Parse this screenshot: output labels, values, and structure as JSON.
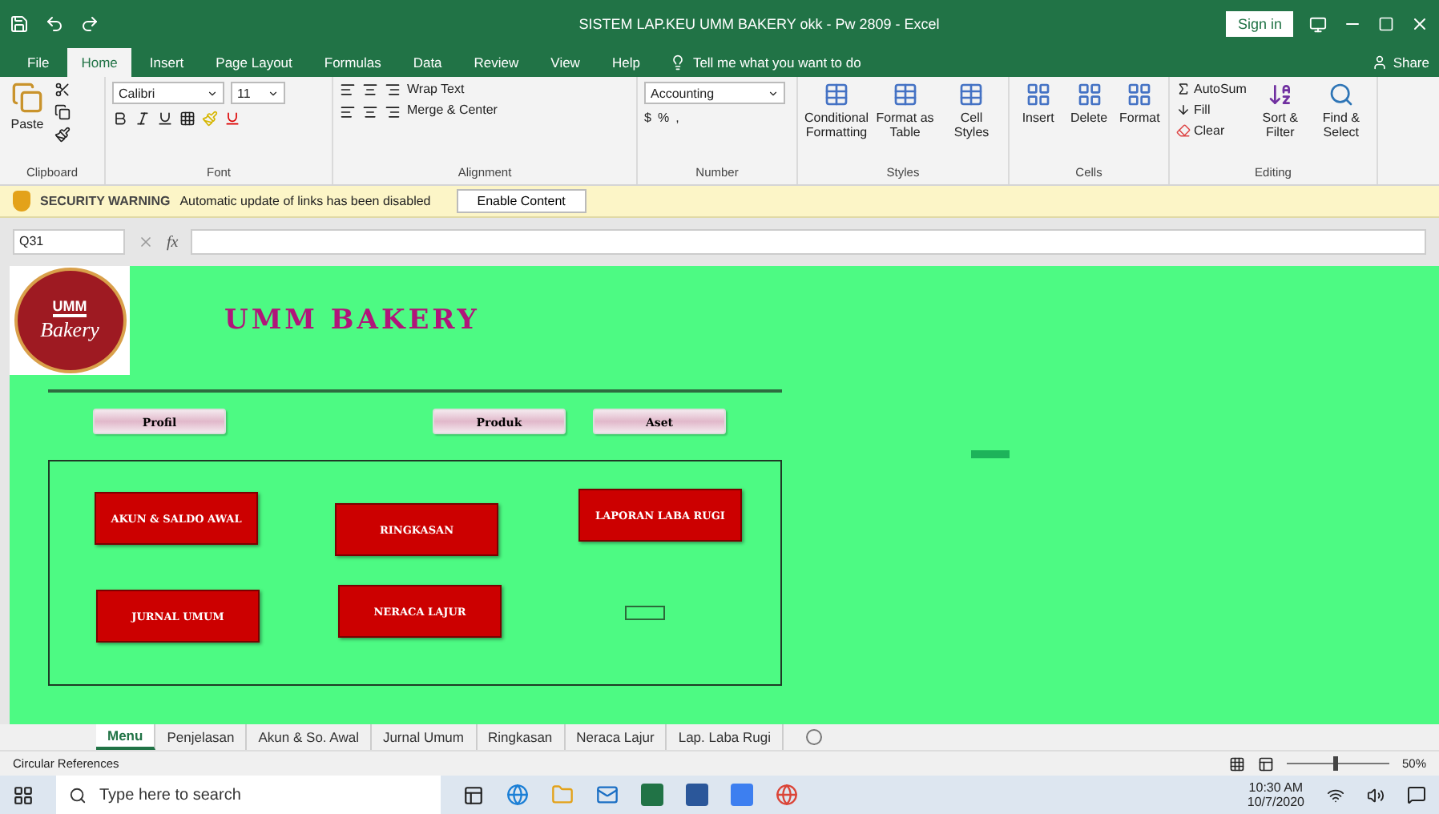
{
  "window": {
    "title": "SISTEM LAP.KEU UMM BAKERY okk - Pw 2809  -  Excel",
    "sign_in": "Sign in"
  },
  "ribbon_tabs": [
    {
      "label": "File",
      "selected": false
    },
    {
      "label": "Home",
      "selected": true
    },
    {
      "label": "Insert",
      "selected": false
    },
    {
      "label": "Page Layout",
      "selected": false
    },
    {
      "label": "Formulas",
      "selected": false
    },
    {
      "label": "Data",
      "selected": false
    },
    {
      "label": "Review",
      "selected": false
    },
    {
      "label": "View",
      "selected": false
    },
    {
      "label": "Help",
      "selected": false
    }
  ],
  "tell_me": "Tell me what you want to do",
  "share": "Share",
  "ribbon": {
    "clipboard": {
      "label": "Clipboard",
      "paste": "Paste"
    },
    "font": {
      "label": "Font",
      "name": "Calibri",
      "size": "11"
    },
    "alignment": {
      "label": "Alignment",
      "wrap": "Wrap Text",
      "merge": "Merge & Center"
    },
    "number": {
      "label": "Number",
      "format": "Accounting",
      "currency": "$",
      "percent": "%",
      "comma": ","
    },
    "styles": {
      "label": "Styles",
      "buttons": [
        "Conditional Formatting",
        "Format as Table",
        "Cell Styles"
      ]
    },
    "cells": {
      "label": "Cells",
      "buttons": [
        "Insert",
        "Delete",
        "Format"
      ]
    },
    "editing": {
      "label": "Editing",
      "autosum": "AutoSum",
      "fill": "Fill",
      "clear": "Clear",
      "sort": "Sort & Filter",
      "find": "Find & Select"
    }
  },
  "warning": {
    "title": "SECURITY WARNING",
    "message": "Automatic update of links has been disabled",
    "button": "Enable Content"
  },
  "formula_bar": {
    "name_box": "Q31",
    "fx": "fx"
  },
  "sheet": {
    "logo_top": "UMM",
    "logo_bottom": "Bakery",
    "title": "UMM BAKERY",
    "nav_buttons": [
      "Profil",
      "Produk",
      "Aset"
    ],
    "menu_buttons": [
      "AKUN & SALDO AWAL",
      "RINGKASAN",
      "LAPORAN LABA RUGI",
      "JURNAL UMUM",
      "NERACA LAJUR"
    ]
  },
  "sheet_tabs": [
    {
      "label": "Menu",
      "selected": true
    },
    {
      "label": "Penjelasan",
      "selected": false
    },
    {
      "label": "Akun & So. Awal",
      "selected": false
    },
    {
      "label": "Jurnal Umum",
      "selected": false
    },
    {
      "label": "Ringkasan",
      "selected": false
    },
    {
      "label": "Neraca Lajur",
      "selected": false
    },
    {
      "label": "Lap. Laba Rugi",
      "selected": false
    }
  ],
  "status_bar": {
    "text": "Circular References",
    "zoom": {
      "level": 0.45,
      "reading": "50%"
    }
  },
  "taskbar": {
    "search": "Type here to search",
    "time": "10:30 AM",
    "date": "10/7/2020"
  }
}
